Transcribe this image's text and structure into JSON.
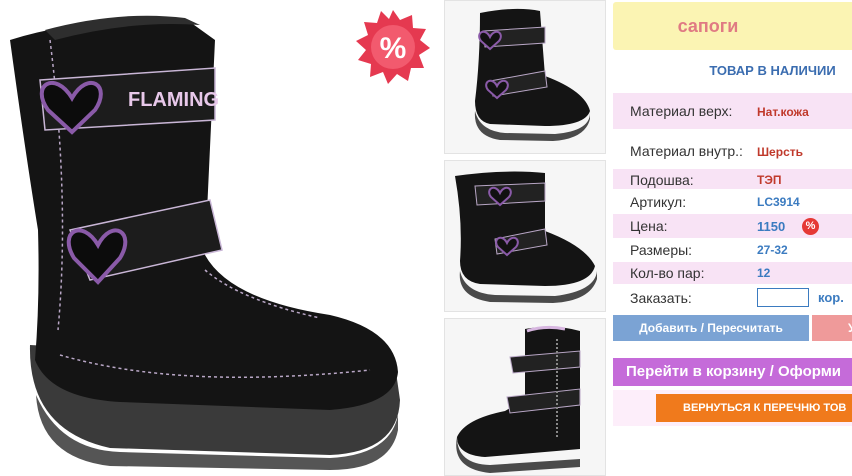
{
  "product": {
    "title": "сапоги",
    "stock_status": "ТОВАР В НАЛИЧИИ",
    "brand_on_boot": "FLAMINGO"
  },
  "details": [
    {
      "label": "Материал верх:",
      "value": "Нат.кожа"
    },
    {
      "label": "Материал внутр.:",
      "value": "Шерсть"
    },
    {
      "label": "Подошва:",
      "value": "ТЭП"
    },
    {
      "label": "Артикул:",
      "value": "LC3914"
    },
    {
      "label": "Цена:",
      "value": "1150"
    },
    {
      "label": "Размеры:",
      "value": "27-32"
    },
    {
      "label": "Кол-во пар:",
      "value": "12"
    }
  ],
  "order": {
    "label": "Заказать:",
    "quantity_value": "",
    "unit": "кор."
  },
  "badges": {
    "sale_symbol": "%"
  },
  "buttons": {
    "update": "Добавить / Пересчитать",
    "delete": "У",
    "cart": "Перейти в корзину / Оформи",
    "back": "ВЕРНУТЬСЯ К ПЕРЕЧНЮ ТОВ"
  },
  "colors": {
    "title_bg": "#fbf4b3",
    "title_text": "#e07a83",
    "accent_blue": "#3b7bc0",
    "row_pink": "#f8e3f5",
    "cart_purple": "#c56bd9",
    "back_orange": "#f07a1c"
  }
}
